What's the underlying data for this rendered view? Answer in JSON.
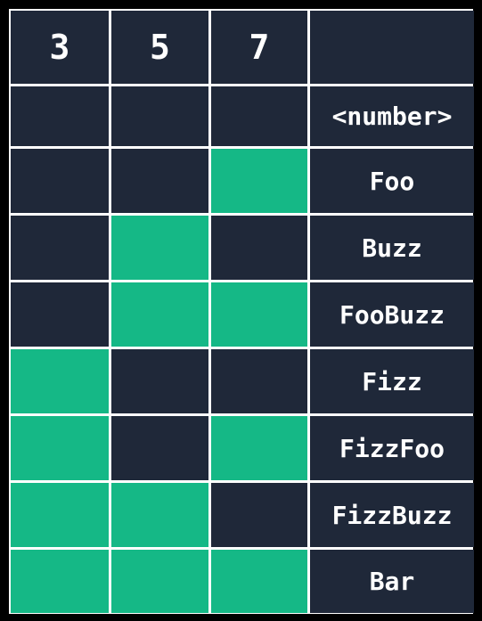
{
  "colors": {
    "cell_off": "#1f2839",
    "cell_on": "#15b886",
    "grid_line": "#ffffff",
    "background": "#000000"
  },
  "headers": [
    "3",
    "5",
    "7",
    ""
  ],
  "rows": [
    {
      "flags": [
        false,
        false,
        false
      ],
      "label": "<number>"
    },
    {
      "flags": [
        false,
        false,
        true
      ],
      "label": "Foo"
    },
    {
      "flags": [
        false,
        true,
        false
      ],
      "label": "Buzz"
    },
    {
      "flags": [
        false,
        true,
        true
      ],
      "label": "FooBuzz"
    },
    {
      "flags": [
        true,
        false,
        false
      ],
      "label": "Fizz"
    },
    {
      "flags": [
        true,
        false,
        true
      ],
      "label": "FizzFoo"
    },
    {
      "flags": [
        true,
        true,
        false
      ],
      "label": "FizzBuzz"
    },
    {
      "flags": [
        true,
        true,
        true
      ],
      "label": "Bar"
    }
  ]
}
